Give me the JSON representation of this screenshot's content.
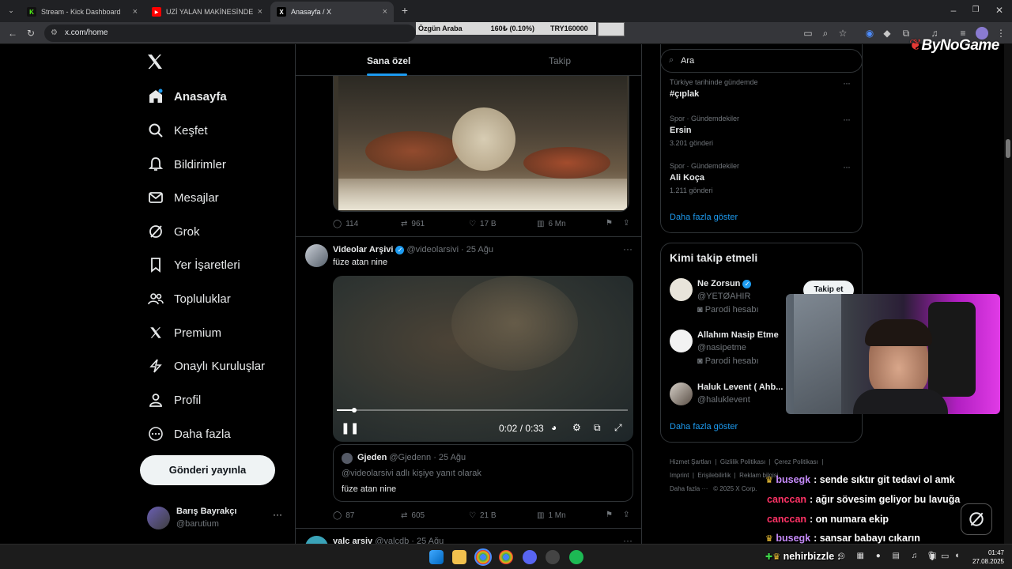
{
  "browser": {
    "tabs": [
      {
        "title": "Stream - Kick Dashboard",
        "icon": "K",
        "color": "#53fc18"
      },
      {
        "title": "UZİ YALAN MAKİNESİNDE! | #P",
        "icon": "▶",
        "color": "#ff0000"
      },
      {
        "title": "Anasayfa / X",
        "icon": "X",
        "color": "#ffffff"
      }
    ],
    "new_tab": "+",
    "url": "x.com/home",
    "ticker": {
      "label": "Özgün Araba",
      "change": "160₺ (0.10%)",
      "goal": "TRY160000"
    },
    "brand_overlay": "ByNoGame"
  },
  "nav": {
    "items": [
      {
        "label": "Anasayfa",
        "icon": "home-icon"
      },
      {
        "label": "Keşfet",
        "icon": "search-icon"
      },
      {
        "label": "Bildirimler",
        "icon": "bell-icon"
      },
      {
        "label": "Mesajlar",
        "icon": "mail-icon"
      },
      {
        "label": "Grok",
        "icon": "grok-icon"
      },
      {
        "label": "Yer İşaretleri",
        "icon": "bookmark-icon"
      },
      {
        "label": "Topluluklar",
        "icon": "people-icon"
      },
      {
        "label": "Premium",
        "icon": "x-logo-icon"
      },
      {
        "label": "Onaylı Kuruluşlar",
        "icon": "lightning-icon"
      },
      {
        "label": "Profil",
        "icon": "person-icon"
      },
      {
        "label": "Daha fazla",
        "icon": "more-circle-icon"
      }
    ],
    "post_button": "Gönderi yayınla",
    "account": {
      "name": "Barış Bayrakçı",
      "handle": "@barutium",
      "more": "···"
    }
  },
  "feed": {
    "tabs": [
      "Sana özel",
      "Takip"
    ],
    "first_tweet_actions": {
      "replies": "114",
      "reposts": "961",
      "likes": "17 B",
      "views": "6 Mn"
    },
    "tweet": {
      "name": "Videolar Arşivi",
      "handle": "@videolarsivi",
      "date": "· 25 Ağu",
      "text": "füze atan nine",
      "video_time": "0:02 / 0:33",
      "video_progress": 0.06,
      "quote": {
        "name": "Gjeden",
        "handle": "@Gjedenn",
        "date": "· 25 Ağu",
        "reply_to": "@videolarsivi adlı kişiye yanıt olarak",
        "text": "füze atan nine"
      },
      "actions": {
        "replies": "87",
        "reposts": "605",
        "likes": "21 B",
        "views": "1 Mn"
      }
    },
    "next_tweet": {
      "name": "yalc arsiv",
      "handle": "@yalcdb",
      "date": "· 25 Ağu"
    }
  },
  "right": {
    "search_placeholder": "Ara",
    "trends": [
      {
        "meta": "Türkiye tarihinde gündemde",
        "title": "#çıplak",
        "count": ""
      },
      {
        "meta": "Spor · Gündemdekiler",
        "title": "Ersin",
        "count": "3.201 gönderi"
      },
      {
        "meta": "Spor · Gündemdekiler",
        "title": "Ali Koça",
        "count": "1.211 gönderi"
      }
    ],
    "show_more": "Daha fazla göster",
    "who_to_follow": {
      "title": "Kimi takip etmeli",
      "users": [
        {
          "name": "Ne Zorsun",
          "handle": "@YETØAHIR",
          "badge": "Parodi hesabı",
          "button": "Takip et"
        },
        {
          "name": "Allahım Nasip Etme",
          "handle": "@nasipetme",
          "badge": "Parodi hesabı"
        },
        {
          "name": "Haluk Levent ( Ahb...",
          "handle": "@haluklevent",
          "badge": ""
        }
      ],
      "show_more": "Daha fazla göster"
    },
    "footer": {
      "links": [
        "Hizmet Şartları",
        "Gizlilik Politikası",
        "Çerez Politikası",
        "Imprint",
        "Erişilebilirlik",
        "Reklam bilgisi",
        "Daha fazla ···",
        "© 2025 X Corp."
      ]
    }
  },
  "chat": [
    {
      "user": "busegk",
      "text": ": sende sıktır git tedavi ol amk",
      "color": "#c58af9",
      "badge": "crown"
    },
    {
      "user": "canccan",
      "text": ": ağır sövesim geliyor bu lavuğa",
      "color": "#ff3366",
      "badge": ""
    },
    {
      "user": "canccan",
      "text": ": on numara ekip",
      "color": "#ff3366",
      "badge": ""
    },
    {
      "user": "busegk",
      "text": ": sansar babayı cıkarın",
      "color": "#c58af9",
      "badge": "crown"
    },
    {
      "user": "nehirbizzle",
      "text": ":",
      "color": "#ffffff",
      "badge": "crown"
    }
  ],
  "taskbar": {
    "time": "01:47",
    "date": "27.08.2025"
  }
}
